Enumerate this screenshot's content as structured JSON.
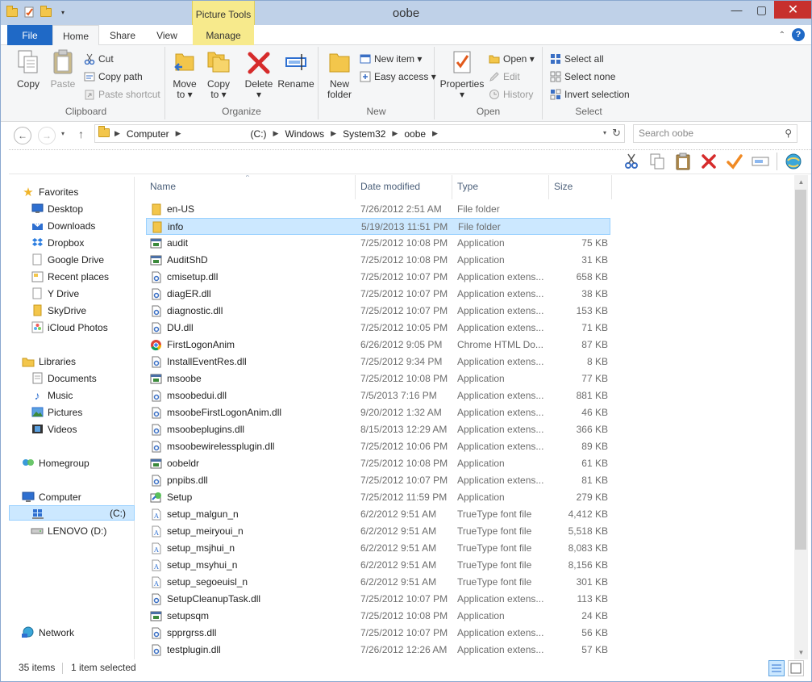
{
  "window": {
    "title": "oobe",
    "context_tab_group": "Picture Tools"
  },
  "ribbon_tabs": {
    "file": "File",
    "home": "Home",
    "share": "Share",
    "view": "View",
    "manage": "Manage"
  },
  "ribbon": {
    "clipboard": {
      "label": "Clipboard",
      "copy": "Copy",
      "paste": "Paste",
      "cut": "Cut",
      "copy_path": "Copy path",
      "paste_shortcut": "Paste shortcut"
    },
    "organize": {
      "label": "Organize",
      "move_to": "Move",
      "move_to_sub": "to ▾",
      "copy_to": "Copy",
      "copy_to_sub": "to ▾",
      "delete": "Delete",
      "delete_sub": "▾",
      "rename": "Rename"
    },
    "new": {
      "label": "New",
      "new_folder": "New",
      "new_folder_sub": "folder",
      "new_item": "New item ▾",
      "easy_access": "Easy access ▾"
    },
    "open": {
      "label": "Open",
      "properties": "Properties",
      "properties_sub": "▾",
      "open": "Open ▾",
      "edit": "Edit",
      "history": "History"
    },
    "select": {
      "label": "Select",
      "select_all": "Select all",
      "select_none": "Select none",
      "invert": "Invert selection"
    }
  },
  "address": {
    "crumbs": [
      "Computer",
      "(C:)",
      "Windows",
      "System32",
      "oobe"
    ],
    "search_placeholder": "Search oobe"
  },
  "nav": {
    "favorites": "Favorites",
    "fav_items": [
      "Desktop",
      "Downloads",
      "Dropbox",
      "Google Drive",
      "Recent places",
      "Y Drive",
      "SkyDrive",
      "iCloud Photos"
    ],
    "libraries": "Libraries",
    "lib_items": [
      "Documents",
      "Music",
      "Pictures",
      "Videos"
    ],
    "homegroup": "Homegroup",
    "computer": "Computer",
    "drive_c": "(C:)",
    "drive_d": "LENOVO (D:)",
    "network": "Network"
  },
  "columns": {
    "name": "Name",
    "date": "Date modified",
    "type": "Type",
    "size": "Size"
  },
  "files": [
    {
      "name": "en-US",
      "date": "7/26/2012 2:51 AM",
      "type": "File folder",
      "size": "",
      "icon": "folder"
    },
    {
      "name": "info",
      "date": "5/19/2013 11:51 PM",
      "type": "File folder",
      "size": "",
      "icon": "folder"
    },
    {
      "name": "audit",
      "date": "7/25/2012 10:08 PM",
      "type": "Application",
      "size": "75 KB",
      "icon": "app"
    },
    {
      "name": "AuditShD",
      "date": "7/25/2012 10:08 PM",
      "type": "Application",
      "size": "31 KB",
      "icon": "app"
    },
    {
      "name": "cmisetup.dll",
      "date": "7/25/2012 10:07 PM",
      "type": "Application extens...",
      "size": "658 KB",
      "icon": "dll"
    },
    {
      "name": "diagER.dll",
      "date": "7/25/2012 10:07 PM",
      "type": "Application extens...",
      "size": "38 KB",
      "icon": "dll"
    },
    {
      "name": "diagnostic.dll",
      "date": "7/25/2012 10:07 PM",
      "type": "Application extens...",
      "size": "153 KB",
      "icon": "dll"
    },
    {
      "name": "DU.dll",
      "date": "7/25/2012 10:05 PM",
      "type": "Application extens...",
      "size": "71 KB",
      "icon": "dll"
    },
    {
      "name": "FirstLogonAnim",
      "date": "6/26/2012 9:05 PM",
      "type": "Chrome HTML Do...",
      "size": "87 KB",
      "icon": "chrome"
    },
    {
      "name": "InstallEventRes.dll",
      "date": "7/25/2012 9:34 PM",
      "type": "Application extens...",
      "size": "8 KB",
      "icon": "dll"
    },
    {
      "name": "msoobe",
      "date": "7/25/2012 10:08 PM",
      "type": "Application",
      "size": "77 KB",
      "icon": "app"
    },
    {
      "name": "msoobedui.dll",
      "date": "7/5/2013 7:16 PM",
      "type": "Application extens...",
      "size": "881 KB",
      "icon": "dll"
    },
    {
      "name": "msoobeFirstLogonAnim.dll",
      "date": "9/20/2012 1:32 AM",
      "type": "Application extens...",
      "size": "46 KB",
      "icon": "dll"
    },
    {
      "name": "msoobeplugins.dll",
      "date": "8/15/2013 12:29 AM",
      "type": "Application extens...",
      "size": "366 KB",
      "icon": "dll"
    },
    {
      "name": "msoobewirelessplugin.dll",
      "date": "7/25/2012 10:06 PM",
      "type": "Application extens...",
      "size": "89 KB",
      "icon": "dll"
    },
    {
      "name": "oobeldr",
      "date": "7/25/2012 10:08 PM",
      "type": "Application",
      "size": "61 KB",
      "icon": "app"
    },
    {
      "name": "pnpibs.dll",
      "date": "7/25/2012 10:07 PM",
      "type": "Application extens...",
      "size": "81 KB",
      "icon": "dll"
    },
    {
      "name": "Setup",
      "date": "7/25/2012 11:59 PM",
      "type": "Application",
      "size": "279 KB",
      "icon": "setup"
    },
    {
      "name": "setup_malgun_n",
      "date": "6/2/2012 9:51 AM",
      "type": "TrueType font file",
      "size": "4,412 KB",
      "icon": "font"
    },
    {
      "name": "setup_meiryoui_n",
      "date": "6/2/2012 9:51 AM",
      "type": "TrueType font file",
      "size": "5,518 KB",
      "icon": "font"
    },
    {
      "name": "setup_msjhui_n",
      "date": "6/2/2012 9:51 AM",
      "type": "TrueType font file",
      "size": "8,083 KB",
      "icon": "font"
    },
    {
      "name": "setup_msyhui_n",
      "date": "6/2/2012 9:51 AM",
      "type": "TrueType font file",
      "size": "8,156 KB",
      "icon": "font"
    },
    {
      "name": "setup_segoeuisl_n",
      "date": "6/2/2012 9:51 AM",
      "type": "TrueType font file",
      "size": "301 KB",
      "icon": "font"
    },
    {
      "name": "SetupCleanupTask.dll",
      "date": "7/25/2012 10:07 PM",
      "type": "Application extens...",
      "size": "113 KB",
      "icon": "dll"
    },
    {
      "name": "setupsqm",
      "date": "7/25/2012 10:08 PM",
      "type": "Application",
      "size": "24 KB",
      "icon": "app"
    },
    {
      "name": "spprgrss.dll",
      "date": "7/25/2012 10:07 PM",
      "type": "Application extens...",
      "size": "56 KB",
      "icon": "dll"
    },
    {
      "name": "testplugin.dll",
      "date": "7/26/2012 12:26 AM",
      "type": "Application extens...",
      "size": "57 KB",
      "icon": "dll"
    }
  ],
  "selected_index": 1,
  "status": {
    "items": "35 items",
    "selected": "1 item selected"
  },
  "colors": {
    "accent": "#1f69c6",
    "selection": "#cce8ff",
    "close": "#c7302d",
    "context_tab": "#f7ea8c"
  }
}
